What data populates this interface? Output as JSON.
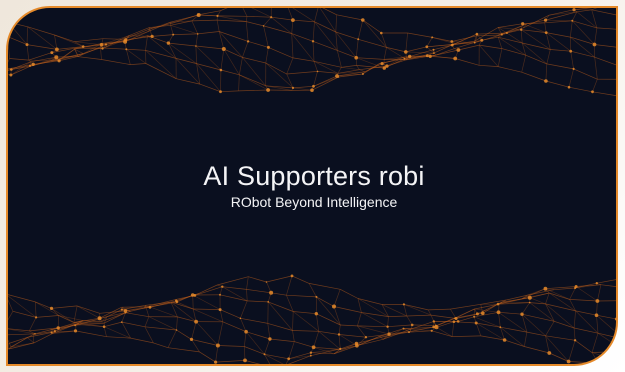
{
  "card": {
    "title": "AI Supporters robi",
    "subtitle": "RObot Beyond Intelligence"
  },
  "colors": {
    "card_background": "#0a0f1f",
    "accent_orange": "#e58a2a",
    "network_lines": "#c2611c",
    "text": "#f4f4f6",
    "page_background": "#efe7dc"
  },
  "icons": [
    "network-wave-graphic-top",
    "network-wave-graphic-bottom"
  ]
}
